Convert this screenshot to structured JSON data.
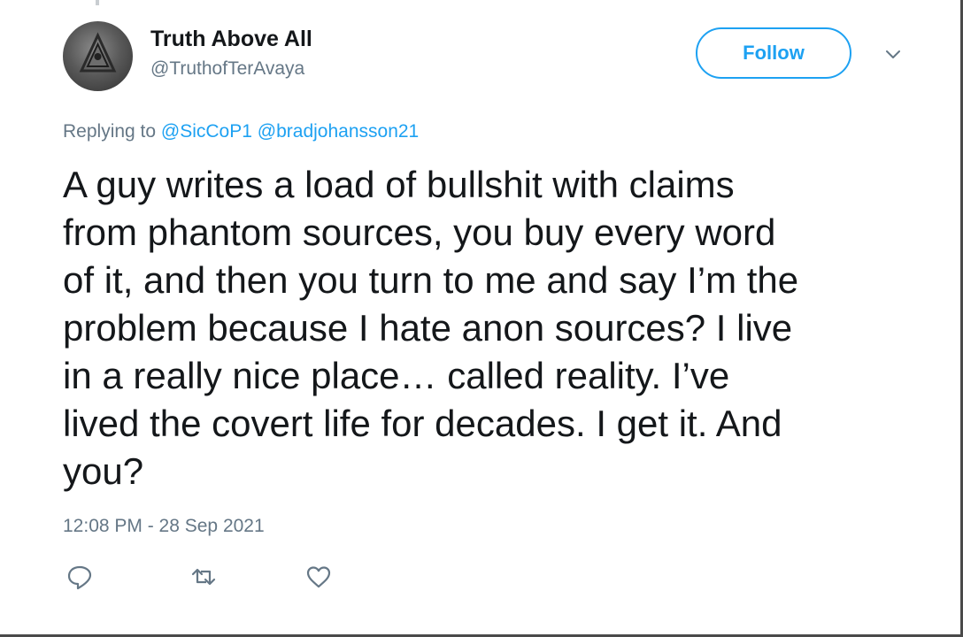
{
  "author": {
    "display_name": "Truth Above All",
    "handle": "@TruthofTerAvaya",
    "avatar_icon": "pyramid-icon"
  },
  "follow_label": "Follow",
  "reply_context": {
    "prefix": "Replying to",
    "mentions": [
      "@SicCoP1",
      "@bradjohansson21"
    ]
  },
  "tweet": {
    "lines": [
      "A guy writes a load of bullshit with claims",
      "from phantom sources, you buy every word",
      "of it, and then you turn to me and say I’m the",
      "problem because I hate anon sources? I live",
      "in a really nice place… called reality. I’ve",
      "lived the covert life for decades. I get it. And",
      "you?"
    ],
    "timestamp": "12:08 PM - 28 Sep 2021"
  },
  "actions": [
    {
      "name": "reply",
      "icon": "reply-icon"
    },
    {
      "name": "retweet",
      "icon": "retweet-icon"
    },
    {
      "name": "like",
      "icon": "heart-icon"
    }
  ],
  "colors": {
    "accent": "#1da1f2",
    "text": "#14171a",
    "secondary": "#657786"
  }
}
